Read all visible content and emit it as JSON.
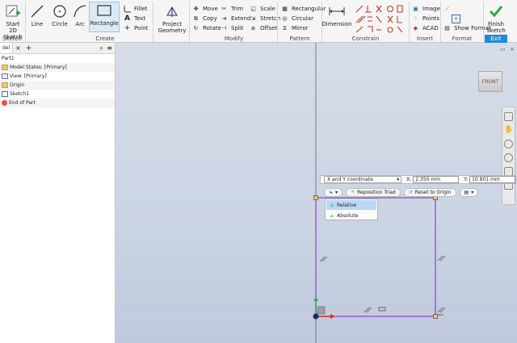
{
  "ribbon": {
    "sketch_panel": {
      "start_sketch": "Start\n2D Sketch",
      "label": "Sketch"
    },
    "create_panel": {
      "line": "Line",
      "circle": "Circle",
      "arc": "Arc",
      "rectangle": "Rectangle",
      "fillet": "Fillet",
      "text": "Text",
      "point": "Point",
      "label": "Create"
    },
    "project_geometry": "Project\nGeometry",
    "modify_panel": {
      "move": "Move",
      "copy": "Copy",
      "rotate": "Rotate",
      "trim": "Trim",
      "extend": "Extend",
      "split": "Split",
      "scale": "Scale",
      "stretch": "Stretch",
      "offset": "Offset",
      "label": "Modify"
    },
    "pattern_panel": {
      "rectangular": "Rectangular",
      "circular": "Circular",
      "mirror": "Mirror",
      "label": "Pattern"
    },
    "constrain_panel": {
      "dimension": "Dimension",
      "label": "Constrain"
    },
    "insert_panel": {
      "image": "Image",
      "points": "Points",
      "acad": "ACAD",
      "label": "Insert"
    },
    "format_panel": {
      "show_format": "Show Format",
      "label": "Format"
    },
    "exit_panel": {
      "finish_sketch": "Finish\nSketch",
      "label": "Exit"
    }
  },
  "browser": {
    "tab": "del",
    "items": [
      {
        "label": "Part1",
        "icon": "part-icon"
      },
      {
        "label": "Model States: [Primary]",
        "icon": "folder-icon"
      },
      {
        "label": "View: [Primary]",
        "icon": "view-icon"
      },
      {
        "label": "Origin",
        "icon": "folder-icon"
      },
      {
        "label": "Sketch1",
        "icon": "sketch-icon"
      },
      {
        "label": "End of Part",
        "icon": "end-icon"
      }
    ]
  },
  "coord_bar": {
    "mode": "X and Y coordinate",
    "x_label": "X:",
    "x_value": "2.350 mm",
    "y_label": "Y:",
    "y_value": "10.801 mm"
  },
  "mini_toolbar": {
    "reposition": "Reposition Triad",
    "reset": "Reset to Origin"
  },
  "menu": {
    "relative": "Relative",
    "absolute": "Absolute"
  },
  "viewcube": {
    "face": "FRONT"
  },
  "colors": {
    "sketch_line": "#8a3df0",
    "exit_blue": "#1c8bd8",
    "finish_green": "#2fa84f"
  }
}
